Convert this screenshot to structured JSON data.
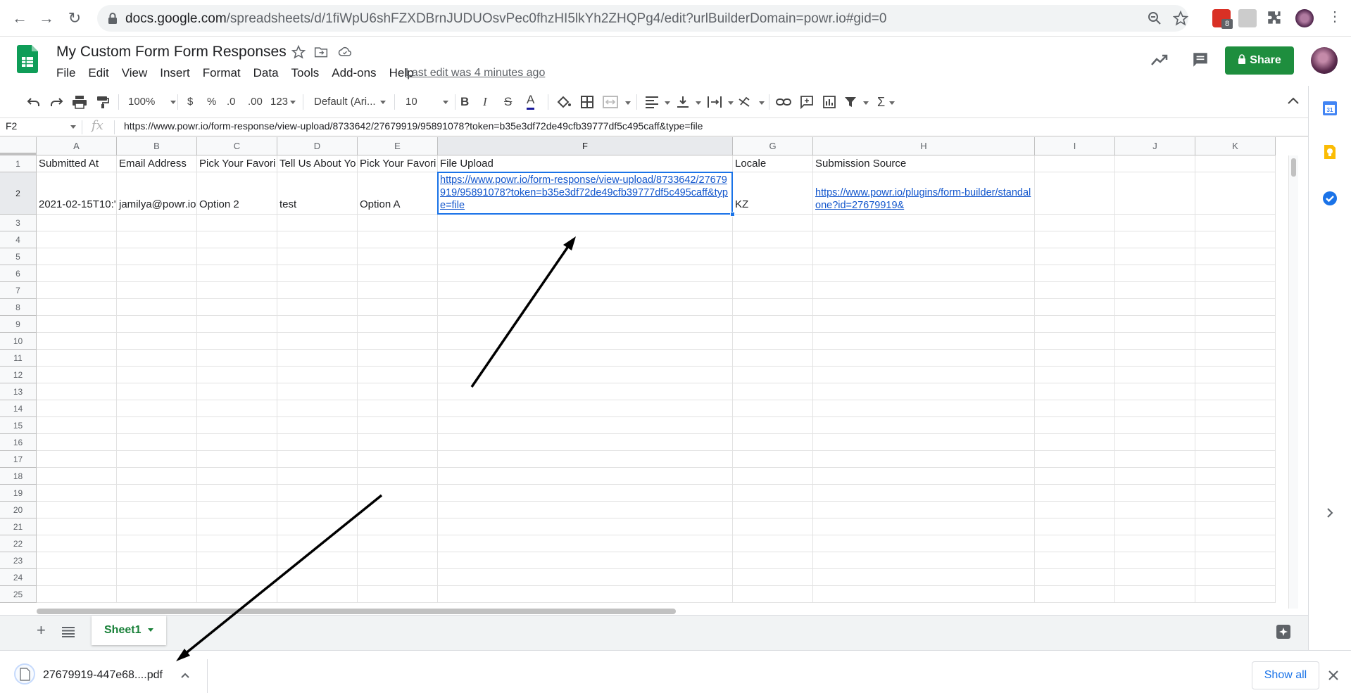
{
  "browser": {
    "url_host": "docs.google.com",
    "url_path": "/spreadsheets/d/1fiWpU6shFZXDBrnJUDUOsvPec0fhzHI5lkYh2ZHQPg4/edit?urlBuilderDomain=powr.io#gid=0",
    "extension_badge": "8"
  },
  "doc": {
    "title": "My Custom Form Form Responses",
    "last_edit": "Last edit was 4 minutes ago",
    "share_label": "Share"
  },
  "menu": [
    "File",
    "Edit",
    "View",
    "Insert",
    "Format",
    "Data",
    "Tools",
    "Add-ons",
    "Help"
  ],
  "toolbar": {
    "zoom": "100%",
    "currency": "$",
    "percent": "%",
    "dec_decrease": ".0",
    "dec_increase": ".00",
    "more_formats": "123",
    "font": "Default (Ari...",
    "font_size": "10",
    "bold": "B",
    "italic": "I",
    "strike": "S",
    "textcolor": "A",
    "functions": "Σ"
  },
  "formula_bar": {
    "name_box": "F2",
    "fx": "fx",
    "formula": "https://www.powr.io/form-response/view-upload/8733642/27679919/95891078?token=b35e3df72de49cfb39777df5c495caff&type=file"
  },
  "grid": {
    "columns": [
      "A",
      "B",
      "C",
      "D",
      "E",
      "F",
      "G",
      "H",
      "I",
      "J",
      "K"
    ],
    "rows": [
      "1",
      "2",
      "3",
      "4",
      "5",
      "6",
      "7",
      "8",
      "9",
      "10",
      "11",
      "12",
      "13",
      "14",
      "15",
      "16",
      "17",
      "18",
      "19",
      "20",
      "21",
      "22",
      "23",
      "24",
      "25"
    ],
    "header_row": {
      "A": "Submitted At",
      "B": "Email Address",
      "C": "Pick Your Favori",
      "D": "Tell Us About Yo",
      "E": "Pick Your Favori",
      "F": "File Upload",
      "G": "Locale",
      "H": "Submission Source"
    },
    "data_row": {
      "A": "2021-02-15T10:'",
      "B": "jamilya@powr.io",
      "C": "Option 2",
      "D": "test",
      "E": "Option A",
      "F": "https://www.powr.io/form-response/view-upload/8733642/27679919/95891078?token=b35e3df72de49cfb39777df5c495caff&type=file",
      "G": "KZ",
      "H": "https://www.powr.io/plugins/form-builder/standalone?id=27679919&"
    }
  },
  "sheets": {
    "active_tab": "Sheet1"
  },
  "download": {
    "filename": "27679919-447e68....pdf",
    "show_all": "Show all"
  }
}
